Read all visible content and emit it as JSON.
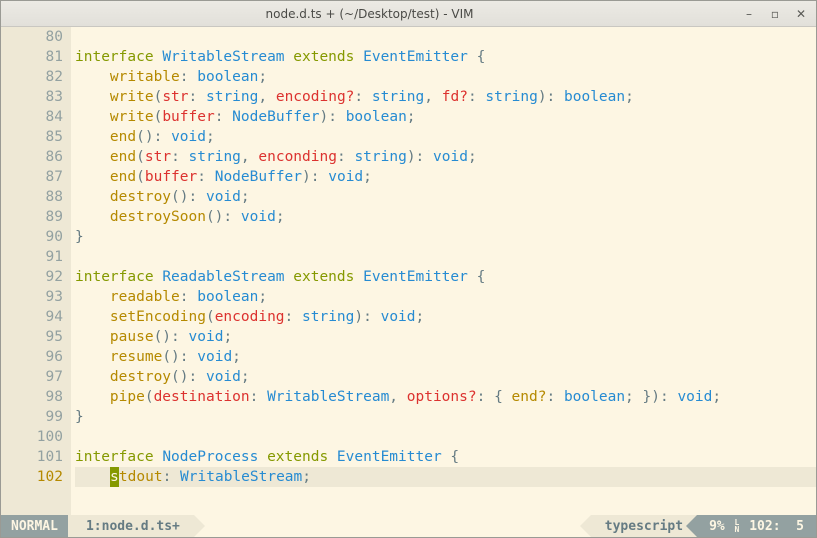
{
  "window": {
    "title": "node.d.ts + (~/Desktop/test) - VIM"
  },
  "status": {
    "mode": "NORMAL",
    "file": "1:node.d.ts+",
    "filetype": "typescript",
    "percent": "9%",
    "line": "102",
    "col": "5"
  },
  "lines": [
    {
      "num": "80",
      "text": ""
    },
    {
      "num": "81",
      "text": "interface WritableStream extends EventEmitter {"
    },
    {
      "num": "82",
      "text": "    writable: boolean;"
    },
    {
      "num": "83",
      "text": "    write(str: string, encoding?: string, fd?: string): boolean;"
    },
    {
      "num": "84",
      "text": "    write(buffer: NodeBuffer): boolean;"
    },
    {
      "num": "85",
      "text": "    end(): void;"
    },
    {
      "num": "86",
      "text": "    end(str: string, enconding: string): void;"
    },
    {
      "num": "87",
      "text": "    end(buffer: NodeBuffer): void;"
    },
    {
      "num": "88",
      "text": "    destroy(): void;"
    },
    {
      "num": "89",
      "text": "    destroySoon(): void;"
    },
    {
      "num": "90",
      "text": "}"
    },
    {
      "num": "91",
      "text": ""
    },
    {
      "num": "92",
      "text": "interface ReadableStream extends EventEmitter {"
    },
    {
      "num": "93",
      "text": "    readable: boolean;"
    },
    {
      "num": "94",
      "text": "    setEncoding(encoding: string): void;"
    },
    {
      "num": "95",
      "text": "    pause(): void;"
    },
    {
      "num": "96",
      "text": "    resume(): void;"
    },
    {
      "num": "97",
      "text": "    destroy(): void;"
    },
    {
      "num": "98",
      "text": "    pipe(destination: WritableStream, options?: { end?: boolean; }): void;"
    },
    {
      "num": "99",
      "text": "}"
    },
    {
      "num": "100",
      "text": ""
    },
    {
      "num": "101",
      "text": "interface NodeProcess extends EventEmitter {"
    },
    {
      "num": "102",
      "text": "    stdout: WritableStream;"
    }
  ],
  "colors": {
    "bg": "#fdf6e3",
    "gutter_bg": "#eee8d5",
    "gutter_fg": "#93a1a1",
    "keyword": "#859900",
    "type": "#268bd2",
    "name": "#b58900",
    "param": "#dc322f",
    "cursor_bg": "#859900",
    "current_line_num": "#b58900"
  }
}
